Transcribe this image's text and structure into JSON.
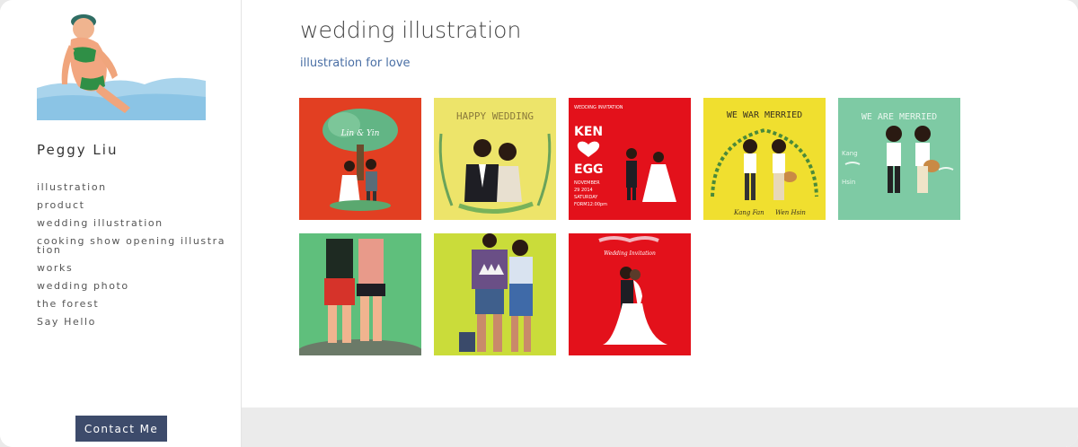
{
  "sidebar": {
    "site_name": "Peggy Liu",
    "logo_icon": "swimmer-illustration-logo",
    "nav": [
      {
        "label": "illustration"
      },
      {
        "label": "product"
      },
      {
        "label": "wedding illustration"
      },
      {
        "label": "cooking show opening illustration"
      },
      {
        "label": "works"
      },
      {
        "label": "wedding photo"
      },
      {
        "label": "the forest"
      },
      {
        "label": "Say Hello"
      }
    ],
    "contact_label": "Contact Me"
  },
  "main": {
    "title": "wedding illustration",
    "subtitle": "illustration for love"
  },
  "gallery": {
    "thumbs": [
      {
        "bg": "#e23f22",
        "icon": "couple-under-tree-thumb",
        "text": "Lin & Yin"
      },
      {
        "bg": "#ede46a",
        "icon": "happy-wedding-thumb",
        "text": "HAPPY WEDDING"
      },
      {
        "bg": "#e3111b",
        "icon": "wedding-invitation-thumb",
        "text": "WEDDING INVITATION",
        "text2": "KEN",
        "text3": "EGG",
        "text4": "NOVEMBER",
        "text5": "29 2014",
        "text6": "SATURDAY",
        "text7": "FORM12:00pm"
      },
      {
        "bg": "#f0df2f",
        "icon": "we-war-merried-thumb",
        "text": "WE WAR MERRIED",
        "text2": "Kang Fan",
        "text3": "Wen Hsin"
      },
      {
        "bg": "#7ecaa4",
        "icon": "we-are-merried-thumb",
        "text": "WE ARE MERRIED",
        "text2": "Kang",
        "text3": "Hsin"
      },
      {
        "bg": "#5fbf7c",
        "icon": "couple-walking-thumb"
      },
      {
        "bg": "#cadc3a",
        "icon": "couple-standing-thumb"
      },
      {
        "bg": "#e3111b",
        "icon": "bride-groom-dance-thumb",
        "text": "Wedding Invitation"
      }
    ]
  },
  "colors": {
    "accent": "#3d4b6b",
    "subtitle": "#4a6fa5",
    "footer": "#ebebeb"
  }
}
